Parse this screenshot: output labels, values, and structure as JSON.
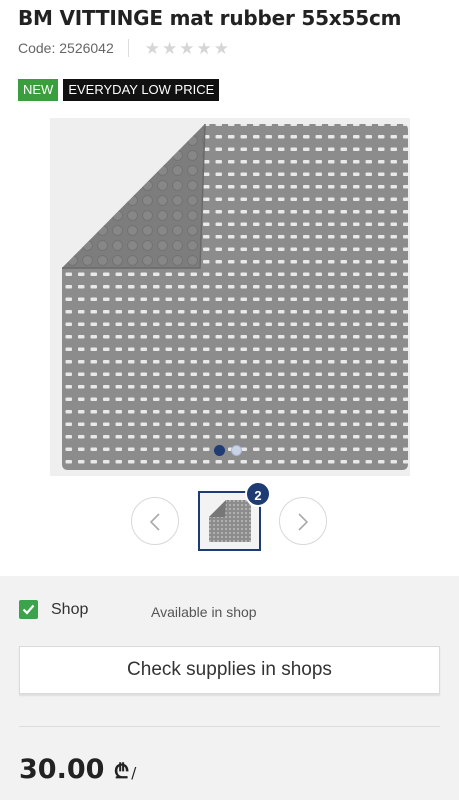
{
  "product": {
    "title": "BM VITTINGE mat rubber 55x55cm",
    "code": "Code: 2526042",
    "rating_stars": 5,
    "rating_filled": 0
  },
  "badges": {
    "new": "NEW",
    "edlp": "EVERYDAY LOW PRICE"
  },
  "gallery": {
    "total_images": 2,
    "active_index": 0,
    "thumb_count": "2"
  },
  "availability": {
    "shop_label": "Shop",
    "shop_status": "Available in shop",
    "check_button": "Check supplies in shops"
  },
  "price": {
    "amount": "30.00",
    "currency_symbol": "₾",
    "suffix": "/"
  },
  "colors": {
    "accent_navy": "#1f3b73",
    "new_badge": "#3a9e3f",
    "check_green": "#3aa34b"
  }
}
